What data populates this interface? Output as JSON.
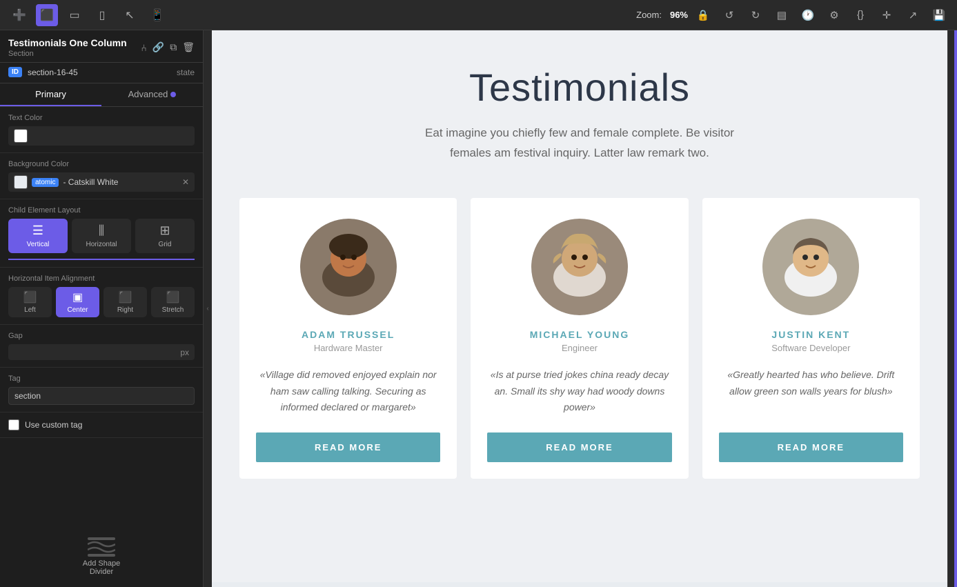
{
  "toolbar": {
    "zoom_prefix": "Zoom:",
    "zoom_value": "96%",
    "icons": [
      "⊕",
      "⊡",
      "▭",
      "⬜",
      "↙",
      "⬜"
    ],
    "right_icons": [
      "🔒",
      "↺",
      "↻",
      "▤",
      "🕐",
      "⚙",
      "{}",
      "+",
      "↗",
      "💾"
    ]
  },
  "left_panel": {
    "title": "Testimonials One Column",
    "subtitle": "Section",
    "id_badge": "ID",
    "id_value": "section-16-45",
    "state_label": "state",
    "header_icons": [
      "fork",
      "link",
      "copy",
      "trash"
    ],
    "tabs": {
      "primary": "Primary",
      "advanced": "Advanced"
    },
    "text_color_label": "Text Color",
    "bg_color_label": "Background Color",
    "bg_color_tag": "atomic - Catskill White",
    "child_element_layout_label": "Child Element Layout",
    "layout_options": [
      {
        "label": "Vertical",
        "active": true
      },
      {
        "label": "Horizontal",
        "active": false
      },
      {
        "label": "Grid",
        "active": false
      }
    ],
    "alignment_label": "Horizontal Item Alignment",
    "alignment_options": [
      {
        "label": "Left",
        "active": false
      },
      {
        "label": "Center",
        "active": true
      },
      {
        "label": "Right",
        "active": false
      },
      {
        "label": "Stretch",
        "active": false
      }
    ],
    "gap_label": "Gap",
    "tag_label": "Tag",
    "tag_default": "section",
    "custom_tag_label": "Use custom tag",
    "add_shape_divider_label": "Add Shape\nDivider"
  },
  "canvas": {
    "section_title": "Testimonials",
    "section_subtitle": "Eat imagine you chiefly few and female complete. Be visitor females am festival inquiry. Latter law remark two.",
    "cards": [
      {
        "name": "ADAM TRUSSEL",
        "title": "Hardware Master",
        "quote": "«Village did removed enjoyed explain nor ham saw calling talking. Securing as informed declared or margaret»",
        "btn_label": "READ MORE",
        "avatar_color": "#7a6a5a"
      },
      {
        "name": "MICHAEL YOUNG",
        "title": "Engineer",
        "quote": "«Is at purse tried jokes china ready decay an. Small its shy way had woody downs power»",
        "btn_label": "READ MORE",
        "avatar_color": "#8a7a6a"
      },
      {
        "name": "JUSTIN KENT",
        "title": "Software Developer",
        "quote": "«Greatly hearted has who believe. Drift allow green son walls years for blush»",
        "btn_label": "READ MORE",
        "avatar_color": "#9a8a7a"
      }
    ]
  }
}
